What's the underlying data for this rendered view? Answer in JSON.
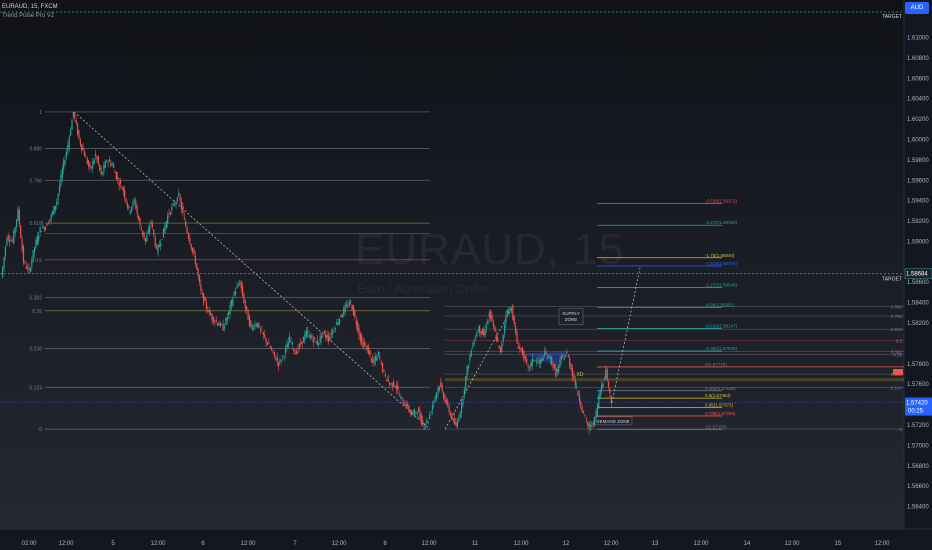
{
  "header": {
    "symbol_line": "EURAUD, 15, FXCM",
    "indicator": "Trend Pulse Pro V2"
  },
  "watermark": {
    "symbol": "EURAUD, 15",
    "description": "Euro / Australian Dollar"
  },
  "currency_button": "AUD",
  "price_axis": {
    "ticks": [
      "1.61000",
      "1.60800",
      "1.60600",
      "1.60400",
      "1.60200",
      "1.60000",
      "1.59800",
      "1.59600",
      "1.59400",
      "1.59200",
      "1.59000",
      "1.58600",
      "1.58400",
      "1.58200",
      "1.57800",
      "1.57600",
      "1.57200",
      "1.57000",
      "1.56800",
      "1.56600",
      "1.56400"
    ],
    "target_label": "TARGET",
    "target_price": "1.58684",
    "current_price": "1.57420",
    "countdown": "00:25"
  },
  "time_axis": [
    "02:00",
    "12:00",
    "5",
    "12:00",
    "6",
    "12:00",
    "7",
    "12:00",
    "8",
    "12:00",
    "11",
    "12:00",
    "12",
    "12:00",
    "13",
    "12:00",
    "14",
    "12:00",
    "15",
    "12:00"
  ],
  "zones": {
    "supply": "SUPPLY ZONE",
    "demand": "DEMAND ZONE"
  },
  "left_fib_labels": [
    "1",
    "0.886",
    "0.786",
    "0.618",
    "0.5",
    "0.382",
    "0.35",
    "0.236",
    "0.124",
    "0"
  ],
  "right_fib_labels": [
    "-2.618(1.59371)",
    "-2.272(1.59159)",
    "-1.75(1.58840)",
    "-1.618(1.58759)",
    "-1.272(1.58548)",
    "-0.95(1.58351)",
    "-0.618(1.58147)",
    "-0.382(1.57925)",
    "0(1.57770)",
    "0.382(1.57536)",
    "0.5(1.57464)",
    "0.65(1.57372)",
    "0.786(1.57289)",
    "1(1.57158)"
  ],
  "mid_fib_labels": [
    "0.886",
    "0.786",
    "0.618",
    "0.5",
    "0.382",
    "0.35",
    "0.236",
    "0.124",
    "0"
  ],
  "pattern_label": "XD",
  "colors": {
    "up": "#26a69a",
    "down": "#ef5350",
    "accent": "#2962ff",
    "target": "#2a9d8f"
  },
  "chart_data": {
    "type": "candlestick",
    "symbol": "EURAUD",
    "timeframe": "15",
    "y_range": [
      1.562,
      1.6125
    ],
    "current_price": 1.5742,
    "target_price": 1.58684,
    "target_price_top": 1.6125,
    "swing_high": 1.6027,
    "swing_low": 1.5716,
    "path": [
      [
        0,
        1.5865
      ],
      [
        1,
        1.5905
      ],
      [
        2,
        1.59
      ],
      [
        3,
        1.593
      ],
      [
        4,
        1.588
      ],
      [
        5,
        1.587
      ],
      [
        6,
        1.5895
      ],
      [
        7,
        1.5912
      ],
      [
        8,
        1.5915
      ],
      [
        9,
        1.5925
      ],
      [
        10,
        1.594
      ],
      [
        11,
        1.597
      ],
      [
        12,
        1.5995
      ],
      [
        13,
        1.6027
      ],
      [
        14,
        1.6
      ],
      [
        15,
        1.5985
      ],
      [
        16,
        1.597
      ],
      [
        17,
        1.5985
      ],
      [
        18,
        1.5965
      ],
      [
        19,
        1.598
      ],
      [
        20,
        1.5975
      ],
      [
        21,
        1.596
      ],
      [
        22,
        1.595
      ],
      [
        23,
        1.593
      ],
      [
        24,
        1.594
      ],
      [
        25,
        1.5915
      ],
      [
        26,
        1.59
      ],
      [
        27,
        1.592
      ],
      [
        28,
        1.589
      ],
      [
        29,
        1.5905
      ],
      [
        30,
        1.5925
      ],
      [
        31,
        1.5935
      ],
      [
        32,
        1.5945
      ],
      [
        33,
        1.592
      ],
      [
        34,
        1.59
      ],
      [
        35,
        1.588
      ],
      [
        36,
        1.585
      ],
      [
        37,
        1.5835
      ],
      [
        38,
        1.5825
      ],
      [
        39,
        1.582
      ],
      [
        40,
        1.5815
      ],
      [
        41,
        1.583
      ],
      [
        42,
        1.585
      ],
      [
        43,
        1.586
      ],
      [
        44,
        1.5835
      ],
      [
        45,
        1.5815
      ],
      [
        46,
        1.582
      ],
      [
        47,
        1.581
      ],
      [
        48,
        1.58
      ],
      [
        49,
        1.579
      ],
      [
        50,
        1.578
      ],
      [
        51,
        1.579
      ],
      [
        52,
        1.5805
      ],
      [
        53,
        1.579
      ],
      [
        54,
        1.58
      ],
      [
        55,
        1.581
      ],
      [
        56,
        1.5805
      ],
      [
        57,
        1.58
      ],
      [
        58,
        1.581
      ],
      [
        59,
        1.5805
      ],
      [
        60,
        1.5815
      ],
      [
        61,
        1.5825
      ],
      [
        62,
        1.5835
      ],
      [
        63,
        1.584
      ],
      [
        64,
        1.582
      ],
      [
        65,
        1.58
      ],
      [
        66,
        1.5795
      ],
      [
        67,
        1.578
      ],
      [
        68,
        1.579
      ],
      [
        69,
        1.577
      ],
      [
        70,
        1.576
      ],
      [
        71,
        1.576
      ],
      [
        72,
        1.5745
      ],
      [
        73,
        1.574
      ],
      [
        74,
        1.573
      ],
      [
        75,
        1.5735
      ],
      [
        76,
        1.572
      ],
      [
        77,
        1.5725
      ],
      [
        78,
        1.5745
      ],
      [
        79,
        1.576
      ],
      [
        80,
        1.5745
      ],
      [
        81,
        1.573
      ],
      [
        82,
        1.5718
      ],
      [
        83,
        1.574
      ],
      [
        84,
        1.5775
      ],
      [
        85,
        1.58
      ],
      [
        86,
        1.5815
      ],
      [
        87,
        1.5808
      ],
      [
        88,
        1.583
      ],
      [
        89,
        1.581
      ],
      [
        90,
        1.579
      ],
      [
        91,
        1.583
      ],
      [
        92,
        1.5835
      ],
      [
        93,
        1.58
      ],
      [
        94,
        1.579
      ],
      [
        95,
        1.5775
      ],
      [
        96,
        1.5785
      ],
      [
        97,
        1.578
      ],
      [
        98,
        1.579
      ],
      [
        99,
        1.5785
      ],
      [
        100,
        1.577
      ],
      [
        101,
        1.5785
      ],
      [
        102,
        1.579
      ],
      [
        103,
        1.577
      ],
      [
        104,
        1.575
      ],
      [
        105,
        1.573
      ],
      [
        106,
        1.5716
      ],
      [
        107,
        1.5725
      ],
      [
        108,
        1.5755
      ],
      [
        109,
        1.5773
      ],
      [
        110,
        1.5742
      ]
    ],
    "legend": "none",
    "grid": false
  }
}
